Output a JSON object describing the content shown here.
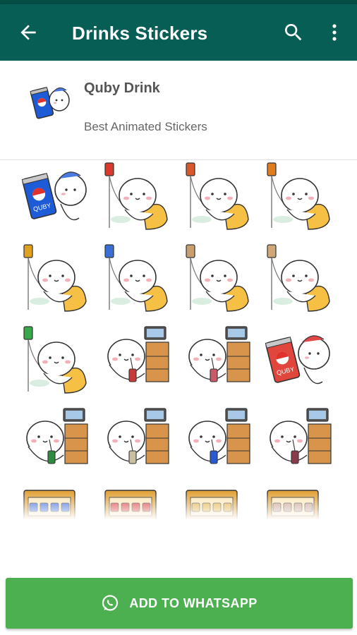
{
  "appbar": {
    "title": "Drinks Stickers",
    "back_icon": "arrow-back-icon",
    "search_icon": "search-icon",
    "more_icon": "more-vert-icon",
    "color": "#075e54"
  },
  "pack": {
    "name": "Quby Drink",
    "subtitle": "Best Animated Stickers",
    "tray_icon": "quby-pepsi-can-tray-icon"
  },
  "stickers": [
    {
      "kind": "can",
      "color": "#1e5bd6",
      "text": "QUBY"
    },
    {
      "kind": "iv",
      "bag": "#d83a2e"
    },
    {
      "kind": "iv",
      "bag": "#d8582e"
    },
    {
      "kind": "iv",
      "bag": "#e07b1e"
    },
    {
      "kind": "iv",
      "bag": "#e0a020"
    },
    {
      "kind": "iv",
      "bag": "#3a6fd8"
    },
    {
      "kind": "iv",
      "bag": "#c8a070"
    },
    {
      "kind": "iv",
      "bag": "#d0a878"
    },
    {
      "kind": "iv",
      "bag": "#3aa84a"
    },
    {
      "kind": "desk",
      "cup": "#c83a3a"
    },
    {
      "kind": "desk",
      "cup": "#c85a6a"
    },
    {
      "kind": "can",
      "color": "#e0463c",
      "text": "QUBY"
    },
    {
      "kind": "desk",
      "cup": "#2e8a3e"
    },
    {
      "kind": "desk",
      "cup": "#c8c0a0"
    },
    {
      "kind": "desk",
      "cup": "#2a5ad0"
    },
    {
      "kind": "desk",
      "cup": "#8a3a4a"
    },
    {
      "kind": "fridge",
      "items": "#3a6ad8"
    },
    {
      "kind": "fridge",
      "items": "#d83a3a"
    },
    {
      "kind": "fridge",
      "items": "#e0b040"
    },
    {
      "kind": "fridge",
      "items": "#c8a090"
    }
  ],
  "button": {
    "label": "ADD TO WHATSAPP",
    "icon": "whatsapp-icon",
    "color": "#4caf50"
  }
}
